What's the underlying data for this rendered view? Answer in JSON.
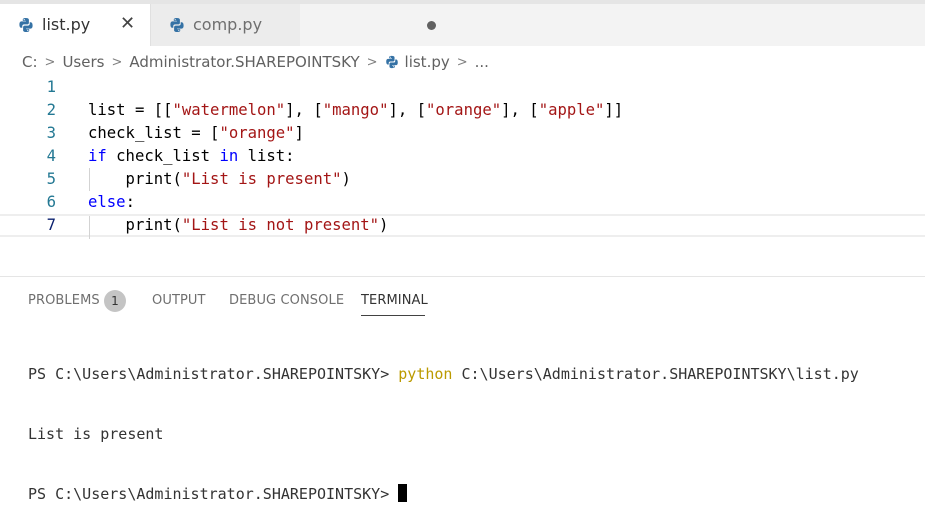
{
  "tabs": [
    {
      "label": "list.py",
      "icon": "python-icon",
      "state": "active"
    },
    {
      "label": "comp.py",
      "icon": "python-icon",
      "state": "modified"
    }
  ],
  "tab_close_glyph": "✕",
  "breadcrumb": {
    "drive": "C:",
    "folder1": "Users",
    "folder2": "Administrator.SHAREPOINTSKY",
    "file": "list.py",
    "more": "..."
  },
  "editor": {
    "lines": [
      {
        "num": "1",
        "indent": 0,
        "tokens": []
      },
      {
        "num": "2",
        "indent": 0,
        "tokens": [
          [
            "t",
            "list = [["
          ],
          [
            "s",
            "\"watermelon\""
          ],
          [
            "t",
            "], ["
          ],
          [
            "s",
            "\"mango\""
          ],
          [
            "t",
            "], ["
          ],
          [
            "s",
            "\"orange\""
          ],
          [
            "t",
            "], ["
          ],
          [
            "s",
            "\"apple\""
          ],
          [
            "t",
            "]]"
          ]
        ]
      },
      {
        "num": "3",
        "indent": 0,
        "tokens": [
          [
            "t",
            "check_list = ["
          ],
          [
            "s",
            "\"orange\""
          ],
          [
            "t",
            "]"
          ]
        ]
      },
      {
        "num": "4",
        "indent": 0,
        "tokens": [
          [
            "k",
            "if"
          ],
          [
            "t",
            " check_list "
          ],
          [
            "k",
            "in"
          ],
          [
            "t",
            " list:"
          ]
        ]
      },
      {
        "num": "5",
        "indent": 1,
        "tokens": [
          [
            "t",
            "    print("
          ],
          [
            "s",
            "\"List is present\""
          ],
          [
            "t",
            ")"
          ]
        ]
      },
      {
        "num": "6",
        "indent": 0,
        "tokens": [
          [
            "k",
            "else"
          ],
          [
            "t",
            ":"
          ]
        ]
      },
      {
        "num": "7",
        "indent": 1,
        "tokens": [
          [
            "t",
            "    print("
          ],
          [
            "s",
            "\"List is not present\""
          ],
          [
            "t",
            ")"
          ]
        ]
      }
    ],
    "current_line": "7"
  },
  "panel": {
    "tabs": [
      "PROBLEMS",
      "OUTPUT",
      "DEBUG CONSOLE",
      "TERMINAL"
    ],
    "active_tab": "TERMINAL",
    "problems_count": "1"
  },
  "terminal": {
    "prompt1": "PS C:\\Users\\Administrator.SHAREPOINTSKY> ",
    "command": "python",
    "command_args": " C:\\Users\\Administrator.SHAREPOINTSKY\\list.py",
    "output": "List is present",
    "prompt2": "PS C:\\Users\\Administrator.SHAREPOINTSKY> "
  },
  "colors": {
    "keyword": "#0000ff",
    "string": "#a31515",
    "line_number": "#237893",
    "terminal_command": "#bb9a00",
    "python_blue": "#3572A5",
    "python_yellow": "#FFD43B"
  }
}
